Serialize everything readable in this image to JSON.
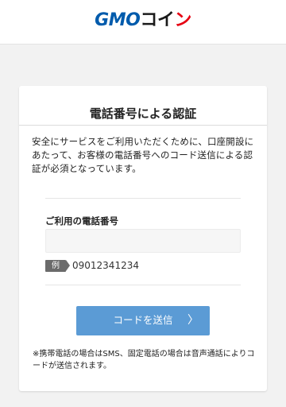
{
  "header": {
    "logo_gmo": "GMO",
    "logo_coin": "コイ",
    "logo_n": "ン"
  },
  "card": {
    "title": "電話番号による認証",
    "intro": "安全にサービスをご利用いただくために、口座開設にあたって、お客様の電話番号へのコード送信による認証が必須となっています。",
    "phone_label": "ご利用の電話番号",
    "phone_value": "",
    "example_badge": "例",
    "example_value": "09012341234",
    "send_button": "コードを送信",
    "send_chevron": "〉",
    "note": "※携帯電話の場合はSMS、固定電話の場合は音声通話によりコードが送信されます。"
  },
  "colors": {
    "brand_blue": "#005bac",
    "brand_red": "#e60012",
    "button": "#5b9bd5",
    "background": "#f2f2f2"
  },
  "icons": {
    "button_arrow": "chevron-right-icon"
  }
}
